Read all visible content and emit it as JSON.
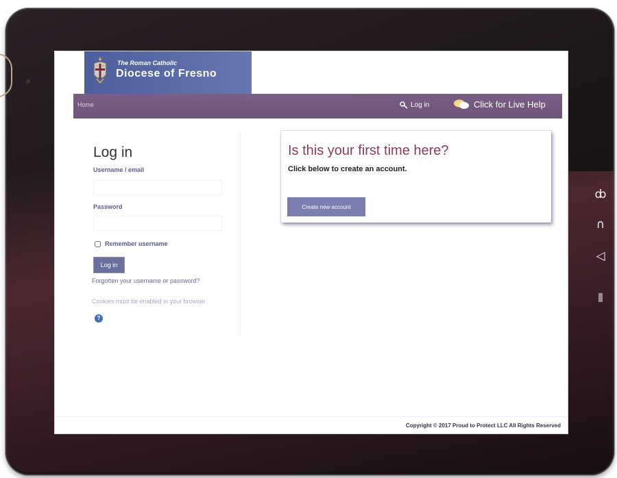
{
  "header": {
    "logo_line1": "The Roman Catholic",
    "logo_line2": "Diocese of Fresno",
    "brand_color": "#5a6aa8"
  },
  "navbar": {
    "home_link": "Home",
    "login_link": "Log in",
    "help_link": "Click for Live Help",
    "bar_color": "#75597f"
  },
  "login": {
    "title": "Log in",
    "username_label": "Username / email",
    "username_value": "",
    "password_label": "Password",
    "password_value": "",
    "remember_label": "Remember username",
    "remember_checked": false,
    "submit_label": "Log in",
    "forgot_link": "Forgotten your username or password?",
    "cookies_note": "Cookies must be enabled in your browser",
    "help_icon": "?"
  },
  "signup": {
    "title": "Is this your first time here?",
    "subtitle": "Click below to create an account.",
    "button_label": "Create new account",
    "title_color": "#8a3a5a"
  },
  "footer": {
    "copyright": "Copyright © 2017 Proud to Protect LLC  All Rights Reserved"
  },
  "device": {
    "buttons": [
      "search-icon",
      "home-icon",
      "back-icon",
      "menu-icon"
    ]
  }
}
